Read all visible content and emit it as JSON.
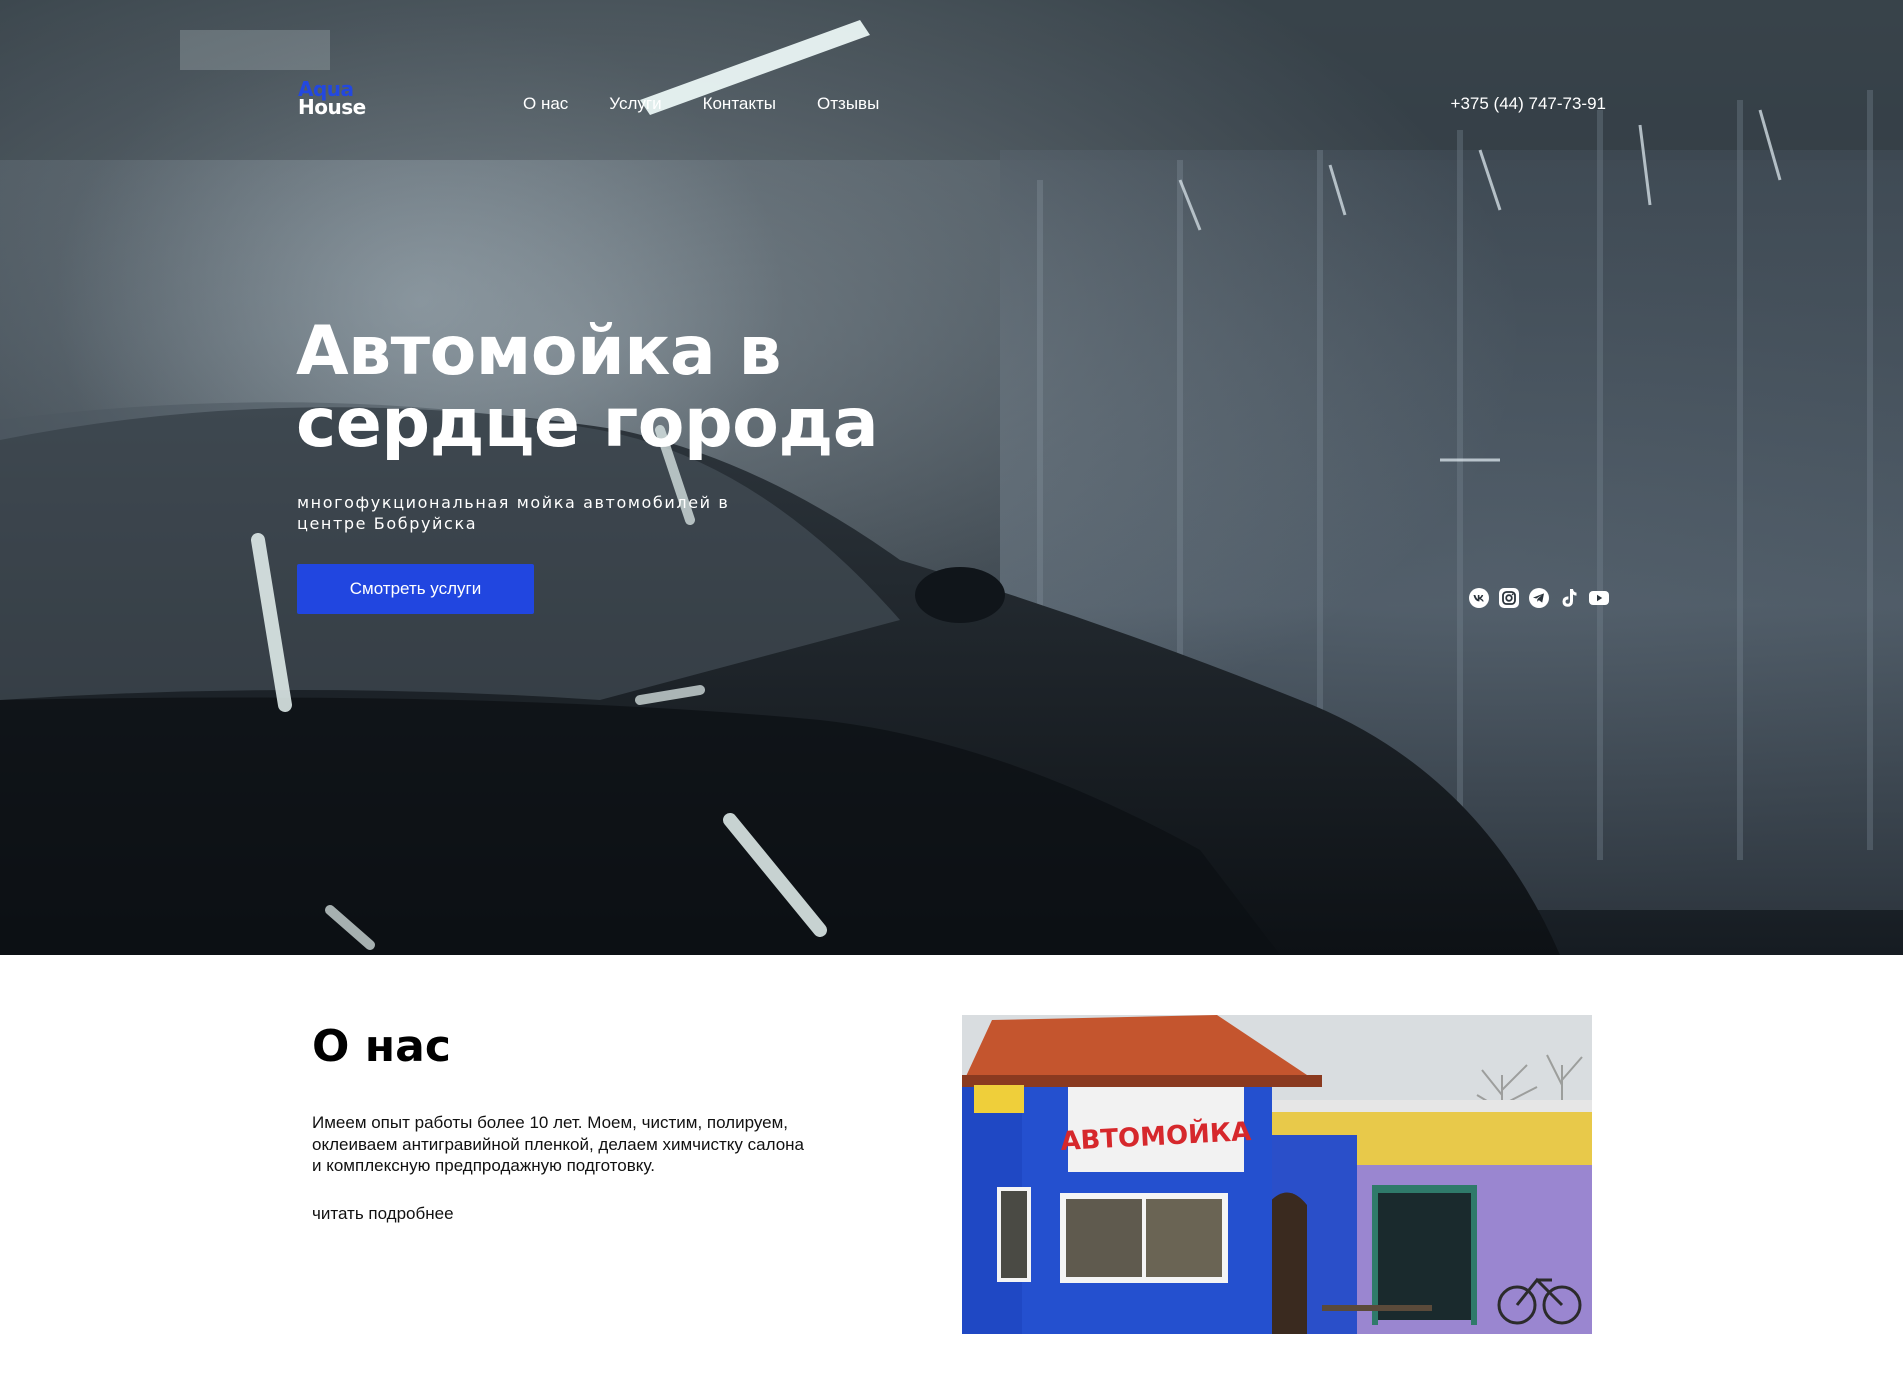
{
  "brand": {
    "logo_top": "Aqua",
    "logo_bottom": "House"
  },
  "nav": {
    "links": [
      "О нас",
      "Услуги",
      "Контакты",
      "Отзывы"
    ],
    "phone": "+375 (44) 747-73-91"
  },
  "hero": {
    "title_line1": "Автомойка в",
    "title_line2": "сердце города",
    "subtitle_line1": "многофукциональная мойка автомобилей в",
    "subtitle_line2": "центре Бобруйска",
    "cta_label": "Смотреть услуги"
  },
  "socials": [
    "vk-icon",
    "instagram-icon",
    "telegram-icon",
    "tiktok-icon",
    "youtube-icon"
  ],
  "about": {
    "title": "О нас",
    "text_line1": "Имеем опыт работы более 10 лет. Моем, чистим, полируем,",
    "text_line2": "оклеиваем антигравийной пленкой, делаем химчистку салона",
    "text_line3": "и комплексную предпродажную подготовку.",
    "more_link": "читать подробнее",
    "photo_sign": "АВТОМОЙКА"
  },
  "colors": {
    "accent": "#2146e0",
    "logo_blue": "#2348e0",
    "hero_dark": "#2a333b",
    "building_blue": "#1f48c4",
    "roof": "#c4552e",
    "wall_yellow": "#e8c94a",
    "wall_purple": "#9a86d0"
  }
}
